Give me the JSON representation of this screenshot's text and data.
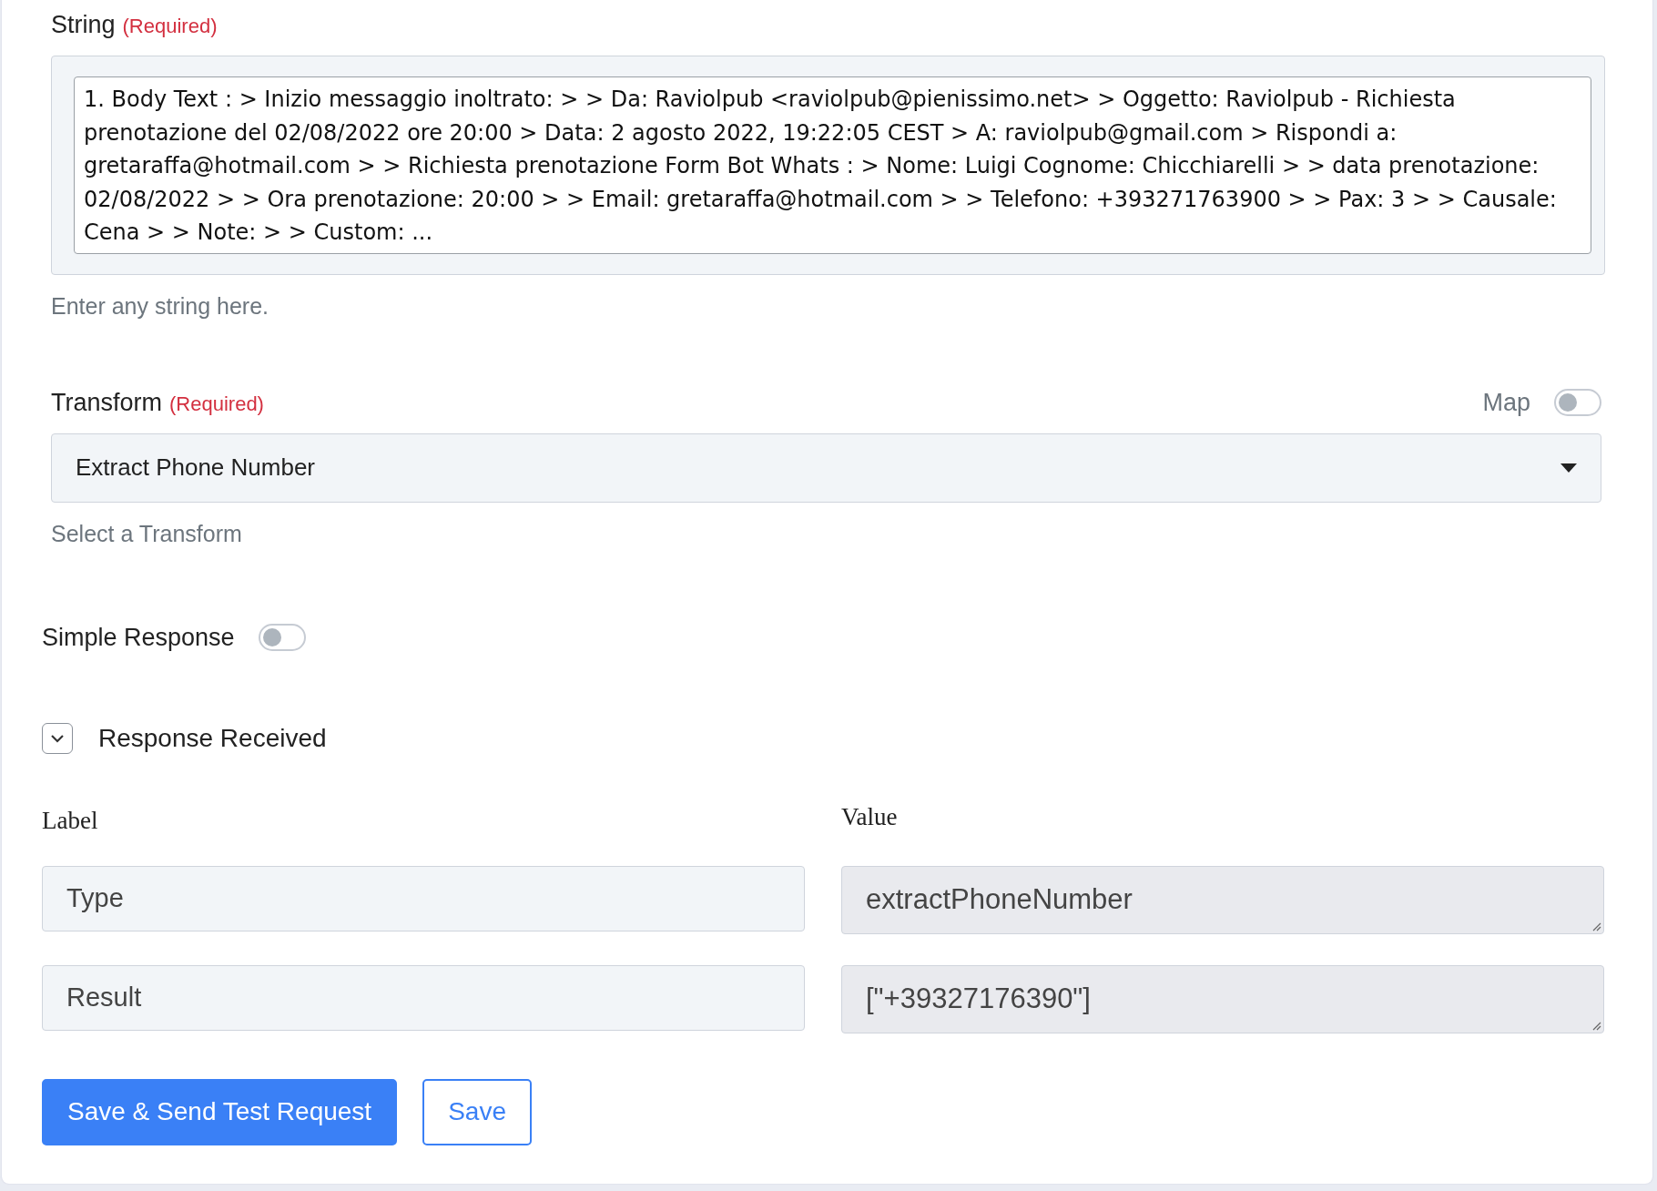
{
  "string_field": {
    "label": "String",
    "required_note": "(Required)",
    "value": "1. Body Text : > Inizio messaggio inoltrato: > > Da: Raviolpub <raviolpub@pienissimo.net> > Oggetto: Raviolpub - Richiesta prenotazione del 02/08/2022 ore 20:00 > Data: 2 agosto 2022, 19:22:05 CEST > A: raviolpub@gmail.com > Rispondi a: gretaraffa@hotmail.com > > Richiesta prenotazione Form Bot Whats : > Nome: Luigi Cognome: Chicchiarelli > > data prenotazione: 02/08/2022 > > Ora prenotazione: 20:00 > > Email: gretaraffa@hotmail.com > > Telefono: +393271763900 > > Pax: 3 > > Causale: Cena > > Note: > > Custom: ...",
    "hint": "Enter any string here."
  },
  "transform_field": {
    "label": "Transform",
    "required_note": "(Required)",
    "map_label": "Map",
    "map_on": false,
    "value": "Extract Phone Number",
    "hint": "Select a Transform"
  },
  "simple_response": {
    "label": "Simple Response",
    "on": false
  },
  "response_received": {
    "title": "Response Received",
    "expanded": true,
    "columns": [
      "Label",
      "Value"
    ],
    "rows": [
      {
        "label": "Type",
        "value": "extractPhoneNumber"
      },
      {
        "label": "Result",
        "value": "[\"+39327176390\"]"
      }
    ]
  },
  "buttons": [
    {
      "label": "Save & Send Test Request",
      "kind": "primary"
    },
    {
      "label": "Save",
      "kind": "outline"
    }
  ]
}
